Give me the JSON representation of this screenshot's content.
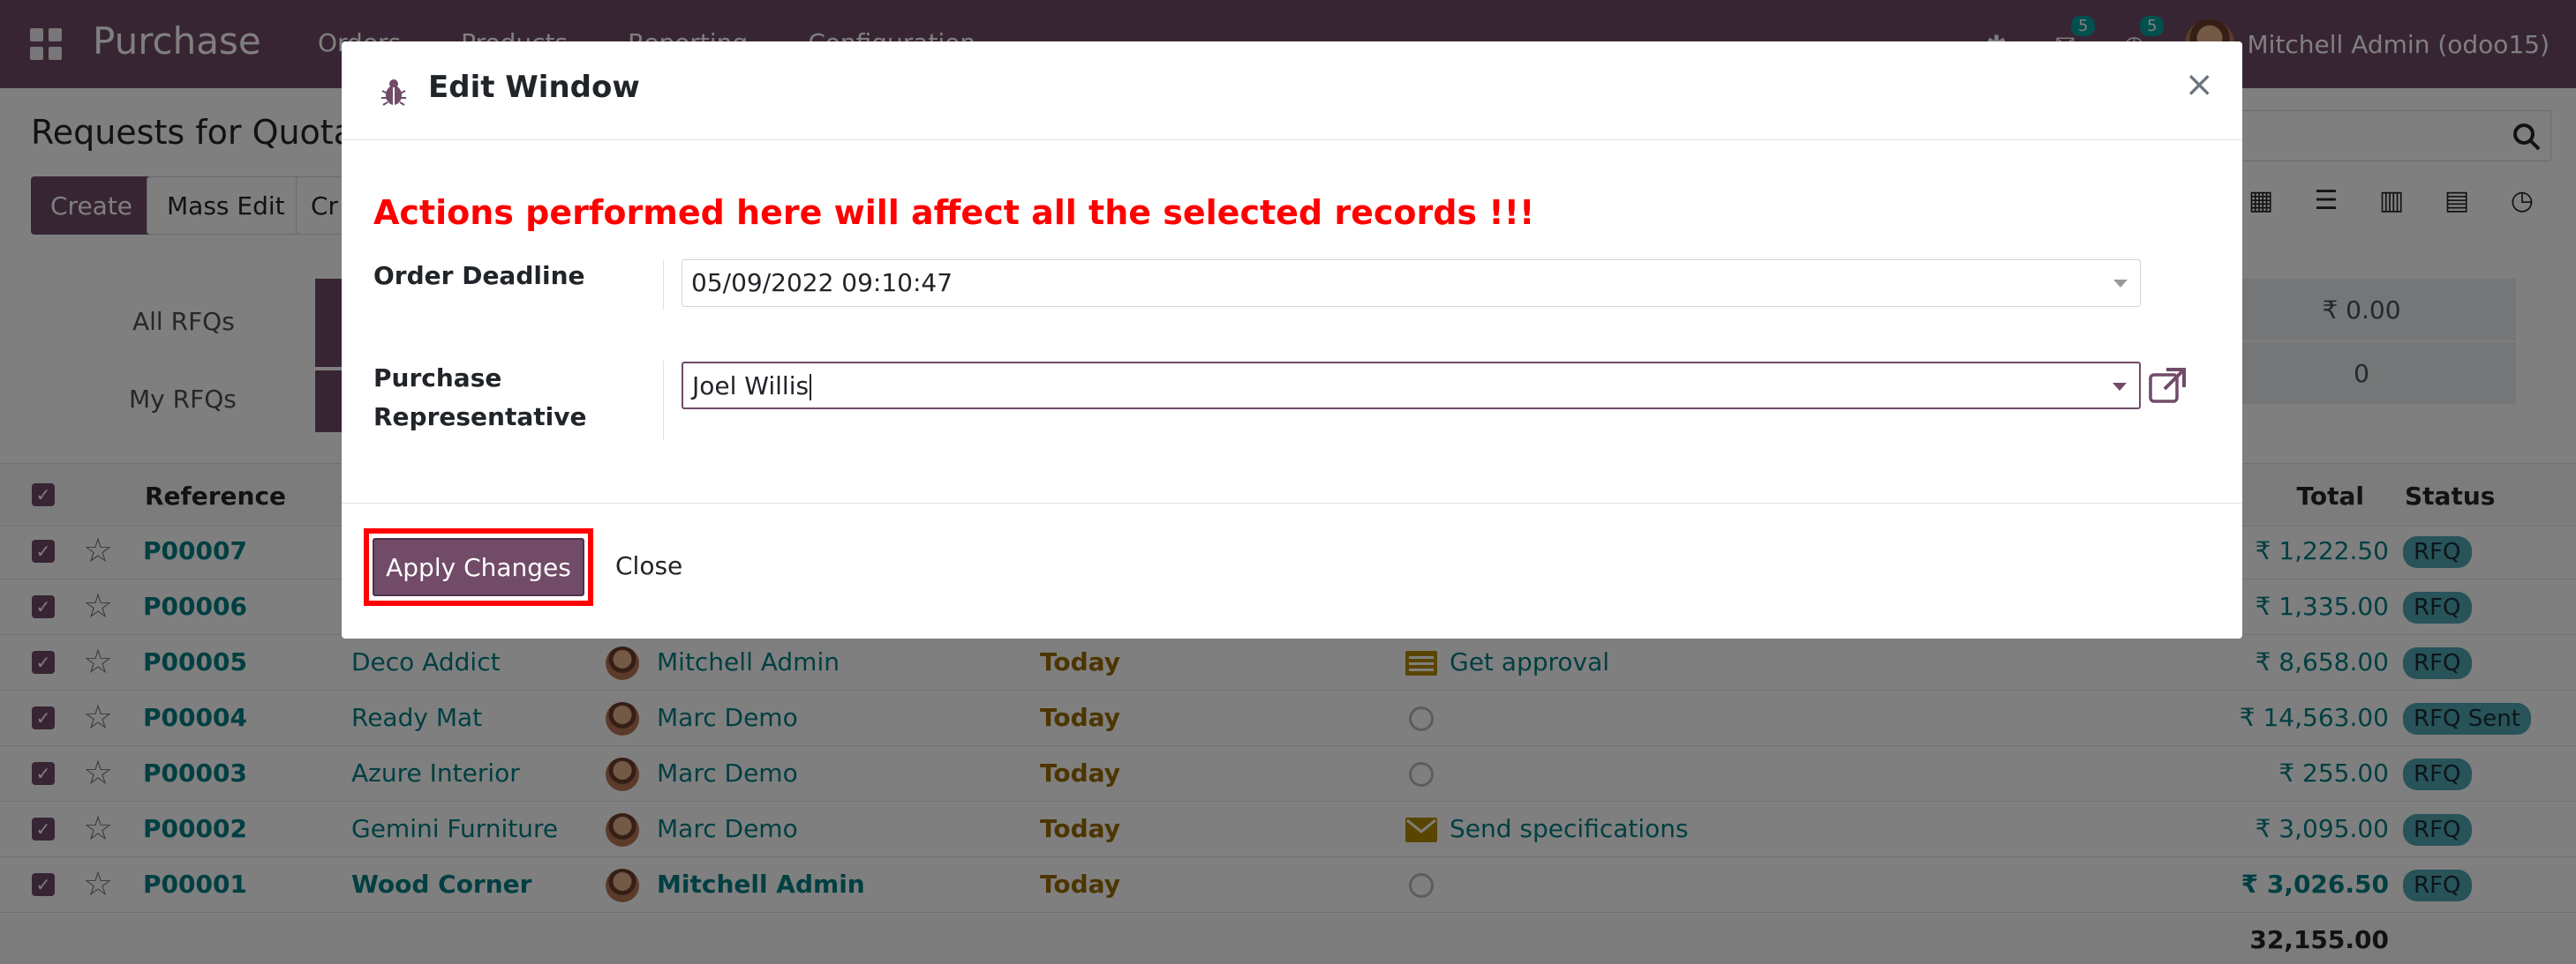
{
  "navbar": {
    "app_name": "Purchase",
    "menu": [
      "Orders",
      "Products",
      "Reporting",
      "Configuration"
    ],
    "activity_count": "5",
    "message_count": "5",
    "user": "Mitchell Admin (odoo15)"
  },
  "control": {
    "title": "Requests for Quotation",
    "create": "Create",
    "mass_edit": "Mass Edit",
    "third_button_partial": "Cr"
  },
  "dashboard": {
    "all_rfqs": "All RFQs",
    "my_rfqs": "My RFQs",
    "right_value_1": "₹ 0.00",
    "right_value_2": "0"
  },
  "table": {
    "headers": {
      "reference": "Reference",
      "total": "Total",
      "status": "Status"
    },
    "rows": [
      {
        "ref": "P00007",
        "vendor": "",
        "buyer": "",
        "deadline": "",
        "activity": "",
        "total": "₹ 1,222.50",
        "status": "RFQ"
      },
      {
        "ref": "P00006",
        "vendor": "",
        "buyer": "",
        "deadline": "",
        "activity": "",
        "total": "₹ 1,335.00",
        "status": "RFQ"
      },
      {
        "ref": "P00005",
        "vendor": "Deco Addict",
        "buyer": "Mitchell Admin",
        "deadline": "Today",
        "activity": "Get approval",
        "total": "₹ 8,658.00",
        "status": "RFQ"
      },
      {
        "ref": "P00004",
        "vendor": "Ready Mat",
        "buyer": "Marc Demo",
        "deadline": "Today",
        "activity": "",
        "total": "₹ 14,563.00",
        "status": "RFQ Sent"
      },
      {
        "ref": "P00003",
        "vendor": "Azure Interior",
        "buyer": "Marc Demo",
        "deadline": "Today",
        "activity": "",
        "total": "₹ 255.00",
        "status": "RFQ"
      },
      {
        "ref": "P00002",
        "vendor": "Gemini Furniture",
        "buyer": "Marc Demo",
        "deadline": "Today",
        "activity": "Send specifications",
        "total": "₹ 3,095.00",
        "status": "RFQ"
      },
      {
        "ref": "P00001",
        "vendor": "Wood Corner",
        "buyer": "Mitchell Admin",
        "deadline": "Today",
        "activity": "",
        "total": "₹ 3,026.50",
        "status": "RFQ"
      }
    ],
    "sum": "32,155.00"
  },
  "modal": {
    "title": "Edit Window",
    "close_glyph": "×",
    "warning": "Actions performed here will affect all the selected records !!!",
    "order_deadline_label": "Order Deadline",
    "order_deadline_value": "05/09/2022 09:10:47",
    "purchase_rep_label_line1": "Purchase",
    "purchase_rep_label_line2": "Representative",
    "purchase_rep_value": "Joel Willis",
    "apply_button": "Apply Changes",
    "close_button": "Close"
  },
  "colors": {
    "brand": "#714b67",
    "link": "#017e84",
    "warning": "#ff0000",
    "today": "#9a6b01"
  }
}
